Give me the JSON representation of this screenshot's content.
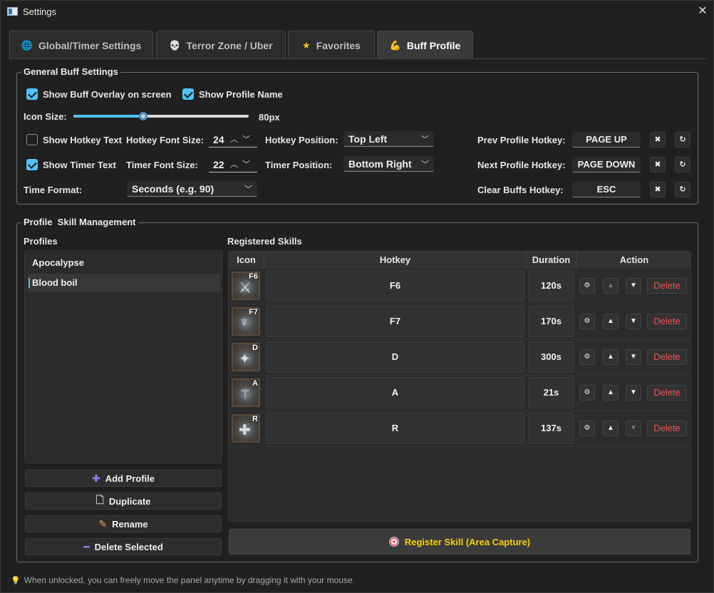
{
  "window": {
    "title": "Settings"
  },
  "tabs": [
    {
      "label": "Global/Timer Settings",
      "icon": "globe-icon"
    },
    {
      "label": "Terror Zone / Uber",
      "icon": "skull-icon"
    },
    {
      "label": "Favorites",
      "icon": "star-icon"
    },
    {
      "label": "Buff Profile",
      "icon": "flexed-arm-icon",
      "active": true
    }
  ],
  "general": {
    "title": "General Buff Settings",
    "show_overlay": {
      "label": "Show Buff Overlay on screen",
      "checked": true
    },
    "show_profile_name": {
      "label": "Show Profile Name",
      "checked": true
    },
    "icon_size": {
      "label": "Icon Size:",
      "value": "80px",
      "slider_fraction": 0.4
    },
    "show_hotkey_text": {
      "label": "Show Hotkey Text",
      "checked": false
    },
    "hotkey_font_size": {
      "label": "Hotkey Font Size:",
      "value": "24"
    },
    "hotkey_position": {
      "label": "Hotkey Position:",
      "value": "Top Left"
    },
    "show_timer_text": {
      "label": "Show Timer Text",
      "checked": true
    },
    "timer_font_size": {
      "label": "Timer Font Size:",
      "value": "22"
    },
    "timer_position": {
      "label": "Timer Position:",
      "value": "Bottom Right"
    },
    "time_format": {
      "label": "Time Format:",
      "value": "Seconds (e.g. 90)"
    },
    "prev_profile_hotkey": {
      "label": "Prev Profile Hotkey:",
      "value": "PAGE UP"
    },
    "next_profile_hotkey": {
      "label": "Next Profile Hotkey:",
      "value": "PAGE DOWN"
    },
    "clear_buffs_hotkey": {
      "label": "Clear Buffs Hotkey:",
      "value": "ESC"
    },
    "clear_icon": "✖",
    "reset_icon": "↻"
  },
  "management": {
    "title": "Profile  Skill Management",
    "profiles_label": "Profiles",
    "profiles": [
      "Apocalypse",
      "Blood boil"
    ],
    "selected_profile": "Blood boil",
    "buttons": {
      "add": "Add Profile",
      "duplicate": "Duplicate",
      "rename": "Rename",
      "delete": "Delete Selected"
    },
    "skills_label": "Registered Skills",
    "columns": [
      "Icon",
      "Hotkey",
      "Duration",
      "Action"
    ],
    "skills": [
      {
        "hotkey": "F6",
        "duration": "120s",
        "icon_tag": "F6",
        "glyph": "⚔",
        "up_enabled": false,
        "down_enabled": true
      },
      {
        "hotkey": "F7",
        "duration": "170s",
        "icon_tag": "F7",
        "glyph": "♆",
        "up_enabled": true,
        "down_enabled": true
      },
      {
        "hotkey": "D",
        "duration": "300s",
        "icon_tag": "D",
        "glyph": "✦",
        "up_enabled": true,
        "down_enabled": true
      },
      {
        "hotkey": "A",
        "duration": "21s",
        "icon_tag": "A",
        "glyph": "⚚",
        "up_enabled": true,
        "down_enabled": true
      },
      {
        "hotkey": "R",
        "duration": "137s",
        "icon_tag": "R",
        "glyph": "✚",
        "up_enabled": true,
        "down_enabled": false
      }
    ],
    "delete_label": "Delete",
    "register_button": "Register Skill (Area Capture)"
  },
  "footer": {
    "text": "When unlocked, you can freely move the panel anytime by dragging it with your mouse."
  },
  "colors": {
    "accent": "#4fc3f7",
    "danger": "#ef5350",
    "register": "#f7d000"
  }
}
